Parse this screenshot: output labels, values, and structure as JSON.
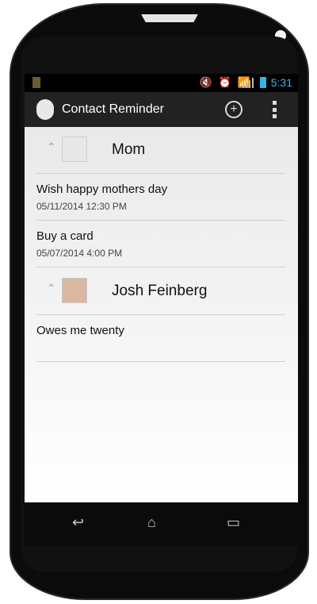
{
  "status": {
    "time": "5:31"
  },
  "actionbar": {
    "title": "Contact Reminder"
  },
  "contacts": [
    {
      "name": "Mom",
      "reminders": [
        {
          "title": "Wish happy mothers day",
          "datetime": "05/11/2014 12:30 PM"
        },
        {
          "title": "Buy a card",
          "datetime": "05/07/2014 4:00 PM"
        }
      ]
    },
    {
      "name": "Josh Feinberg",
      "reminders": [
        {
          "title": "Owes me twenty"
        }
      ]
    }
  ],
  "icons": {
    "add": "add-icon",
    "overflow": "overflow-menu-icon",
    "back": "back-icon",
    "home": "home-icon",
    "recent": "recent-apps-icon"
  },
  "colors": {
    "status_time": "#33b5e5",
    "actionbar_bg": "#222222"
  }
}
